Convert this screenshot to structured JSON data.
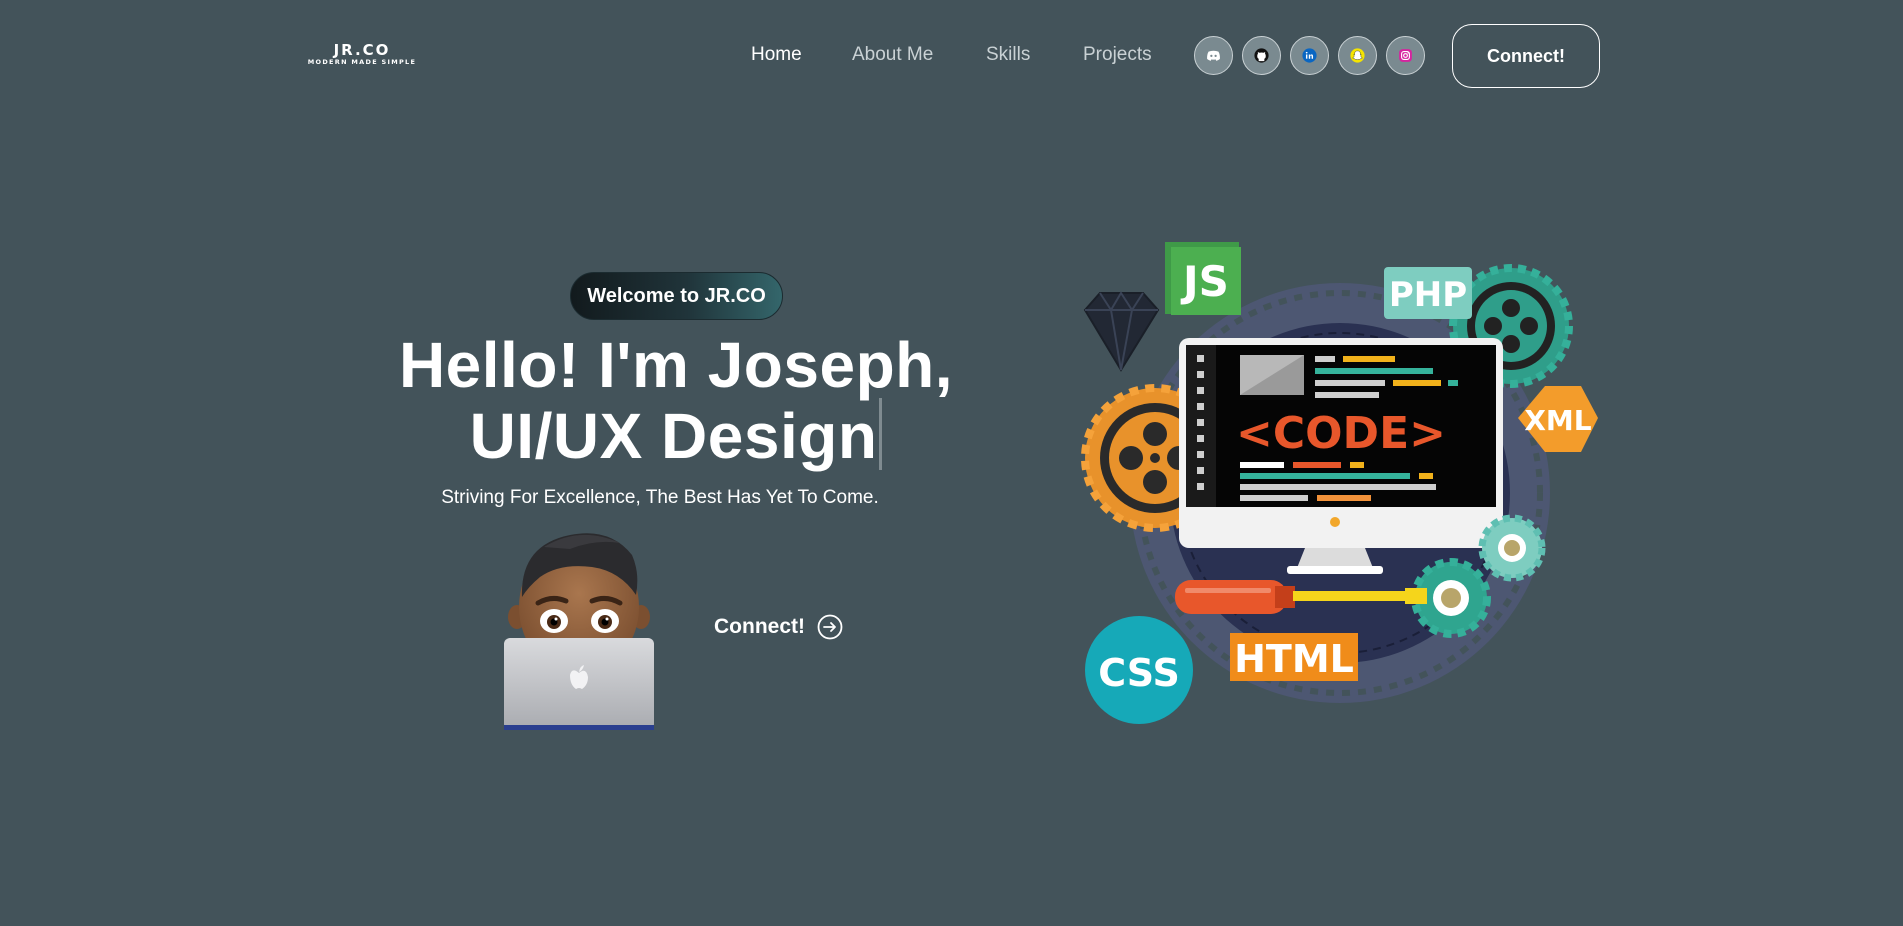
{
  "nav": {
    "logo_main": "JR.CO",
    "logo_tagline": "MODERN MADE SIMPLE",
    "links": [
      {
        "label": "Home",
        "active": true
      },
      {
        "label": "About Me",
        "active": false
      },
      {
        "label": "Skills",
        "active": false
      },
      {
        "label": "Projects",
        "active": false
      }
    ],
    "socials": [
      "discord-icon",
      "github-icon",
      "linkedin-icon",
      "snapchat-icon",
      "instagram-icon"
    ],
    "connect_label": "Connect!"
  },
  "hero": {
    "welcome": "Welcome to JR.CO",
    "title_line1": "Hello! I'm Joseph,",
    "title_line2": "UI/UX Design",
    "subtitle": "Striving For Excellence, The Best Has Yet To Come.",
    "connect_label": "Connect!"
  },
  "illustration": {
    "code_label": "<CODE>",
    "badges": [
      "JS",
      "PHP",
      "XML",
      "CSS",
      "HTML"
    ]
  },
  "colors": {
    "background": "#43535a",
    "text": "#ffffff",
    "nav_inactive": "#c9d1d4",
    "code_orange": "#e8572b",
    "js_green": "#4caf50",
    "php_teal": "#7ecdc0",
    "xml_orange": "#f39c2b",
    "css_cyan": "#16a9b8",
    "html_orange": "#f08c1a"
  }
}
